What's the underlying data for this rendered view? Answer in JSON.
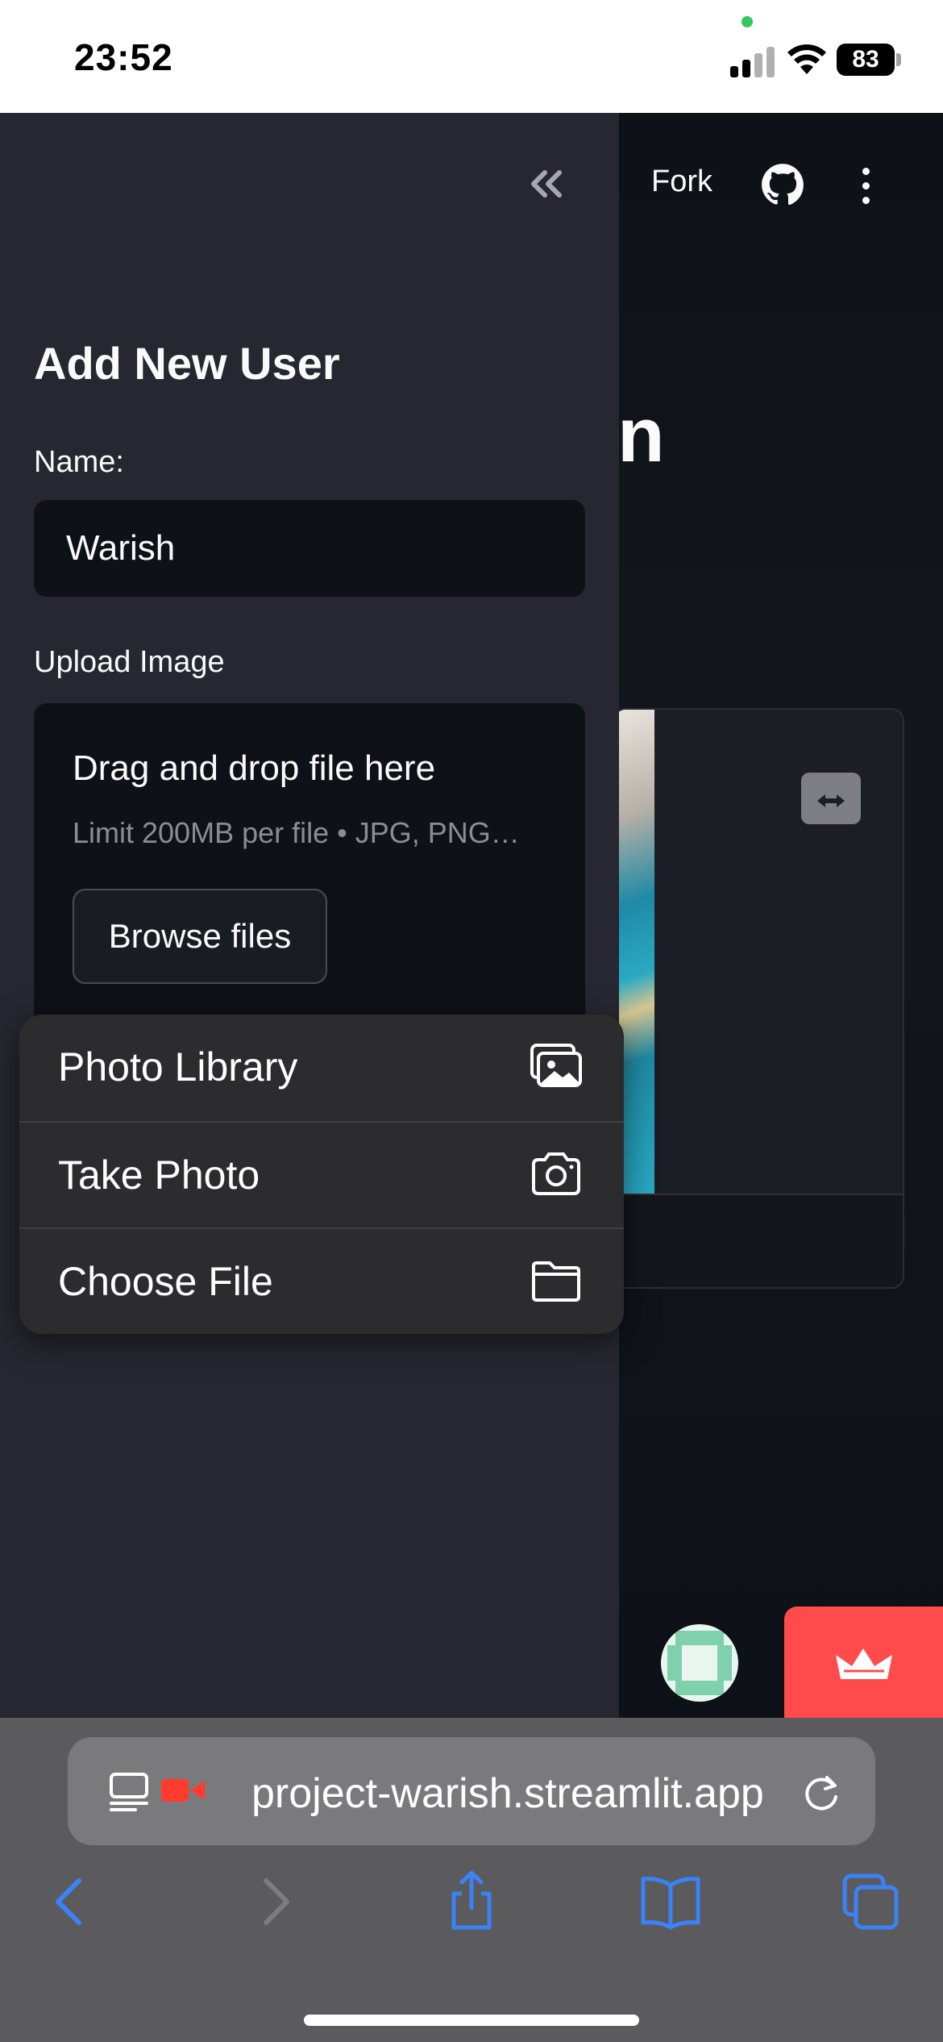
{
  "status_bar": {
    "time": "23:52",
    "battery": "83"
  },
  "toolbar": {
    "fork_label": "Fork"
  },
  "main": {
    "title_fragment": "n"
  },
  "sidebar": {
    "title": "Add New User",
    "name_label": "Name:",
    "name_value": "Warish",
    "upload_label": "Upload Image",
    "dropzone": {
      "title": "Drag and drop file here",
      "limit": "Limit 200MB per file • JPG, PNG…",
      "browse_label": "Browse files"
    }
  },
  "context_menu": {
    "items": [
      {
        "label": "Photo Library",
        "icon": "photo-library-icon"
      },
      {
        "label": "Take Photo",
        "icon": "camera-icon"
      },
      {
        "label": "Choose File",
        "icon": "folder-icon"
      }
    ]
  },
  "safari": {
    "url": "project-warish.streamlit.app"
  },
  "colors": {
    "sidebar_bg": "#262730",
    "main_bg": "#0e1117",
    "accent_red": "#ff4b4b",
    "ios_blue": "#3a82f7"
  }
}
